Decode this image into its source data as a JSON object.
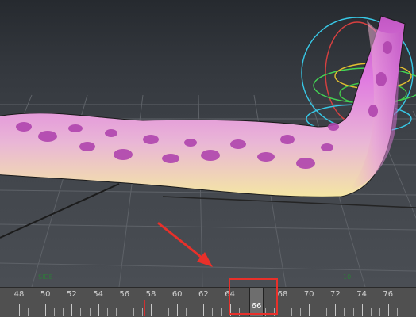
{
  "viewport": {
    "grid_labels": [
      "SIDE",
      "10"
    ],
    "colors": {
      "accent_red": "#e8302a",
      "model_pink": "#d866cc",
      "model_yellow": "#f3e4a6"
    }
  },
  "timeline": {
    "ticks": [
      "48",
      "50",
      "52",
      "54",
      "56",
      "58",
      "60",
      "62",
      "64",
      "66",
      "68",
      "70",
      "72",
      "74",
      "76"
    ],
    "current_frame": "66",
    "key_frames": [
      57
    ]
  },
  "annotations": {
    "arrow_color": "#e8302a",
    "box_color": "#e8302a"
  }
}
